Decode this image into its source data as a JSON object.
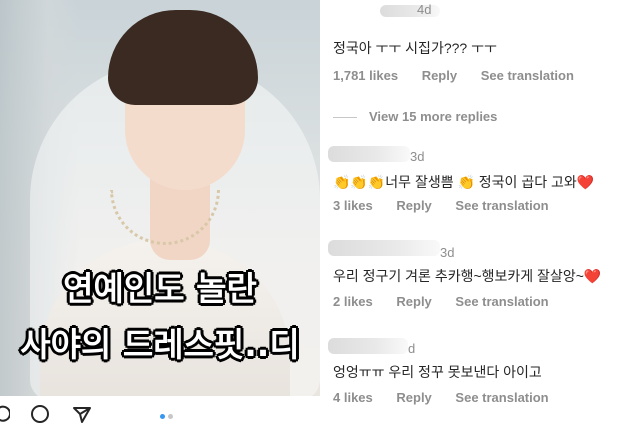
{
  "post": {
    "overlay_line1": "연예인도 놀란",
    "overlay_line2": "사야의 드레스핏..디",
    "icons": [
      "comment-icon",
      "share-icon"
    ],
    "carousel": {
      "count": 2,
      "active_index": 0,
      "active_color": "#3897f0",
      "inactive_color": "#c7c7c7"
    }
  },
  "comments": [
    {
      "time": "4d",
      "text": "정국아 ㅜㅜ 시집가??? ㅜㅜ",
      "likes": "1,781 likes",
      "reply": "Reply",
      "see_translation": "See translation"
    },
    {
      "time": "3d",
      "text_prefix": "👏👏👏너무 잘생쁨 👏 정국이 곱다 고와",
      "heart": "❤️",
      "likes": "3 likes",
      "reply": "Reply",
      "see_translation": "See translation"
    },
    {
      "time": "3d",
      "text_prefix": "우리 정구기 겨론 추카행~행보카게 잘살앙~",
      "heart": "❤️",
      "likes": "2 likes",
      "reply": "Reply",
      "see_translation": "See translation"
    },
    {
      "time": "d",
      "text": "엉엉ㅠㅠ 우리 정꾸 못보낸다 아이고",
      "likes": "4 likes",
      "reply": "Reply",
      "see_translation": "See translation"
    }
  ],
  "view_more_replies": "View 15 more replies",
  "colors": {
    "text": "#262626",
    "secondary": "#8e8e8e",
    "heart": "#ed4956"
  }
}
